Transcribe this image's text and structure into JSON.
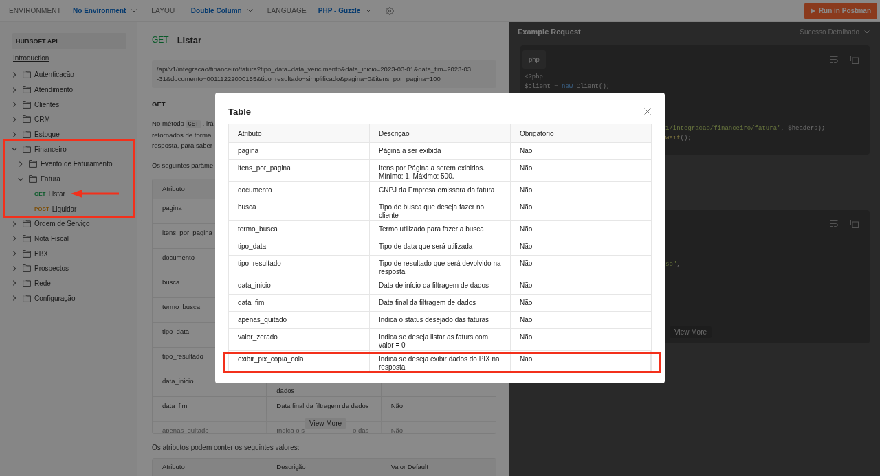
{
  "top_bar": {
    "settings": [
      {
        "label": "ENVIRONMENT",
        "value": "No Environment"
      },
      {
        "label": "LAYOUT",
        "value": "Double Column"
      },
      {
        "label": "LANGUAGE",
        "value": "PHP - Guzzle"
      }
    ],
    "run_button": "Run in Postman"
  },
  "sidebar": {
    "title": "HUBSOFT API",
    "intro_link": "Introduction",
    "items": [
      {
        "kind": "folder",
        "label": "Autenticação",
        "expanded": false,
        "highlighted": false
      },
      {
        "kind": "folder",
        "label": "Atendimento",
        "expanded": false,
        "highlighted": false
      },
      {
        "kind": "folder",
        "label": "Clientes",
        "expanded": false,
        "highlighted": false
      },
      {
        "kind": "folder",
        "label": "CRM",
        "expanded": false,
        "highlighted": false
      },
      {
        "kind": "folder",
        "label": "Estoque",
        "expanded": false,
        "highlighted": false
      },
      {
        "kind": "folder",
        "label": "Financeiro",
        "expanded": true,
        "highlighted": true,
        "children": [
          {
            "kind": "folder",
            "label": "Evento de Faturamento",
            "expanded": false
          },
          {
            "kind": "folder",
            "label": "Fatura",
            "expanded": true,
            "children": [
              {
                "kind": "request",
                "method": "GET",
                "label": "Listar",
                "arrow": true
              },
              {
                "kind": "request",
                "method": "POST",
                "label": "Liquidar",
                "arrow": false
              }
            ]
          }
        ]
      },
      {
        "kind": "folder",
        "label": "Ordem de Serviço",
        "expanded": false,
        "highlighted": false
      },
      {
        "kind": "folder",
        "label": "Nota Fiscal",
        "expanded": false,
        "highlighted": false
      },
      {
        "kind": "folder",
        "label": "PBX",
        "expanded": false,
        "highlighted": false
      },
      {
        "kind": "folder",
        "label": "Prospectos",
        "expanded": false,
        "highlighted": false
      },
      {
        "kind": "folder",
        "label": "Rede",
        "expanded": false,
        "highlighted": false
      },
      {
        "kind": "folder",
        "label": "Configuração",
        "expanded": false,
        "highlighted": false
      }
    ]
  },
  "main": {
    "method": "GET",
    "title": "Listar",
    "url": "/api/v1/integracao/financeiro/fatura?tipo_data=data_vencimento&data_inicio=2023-03-01&data_fim=2023-03-31&documento=00111222000155&tipo_resultado=simplificado&pagina=0&itens_por_pagina=100",
    "section_heading": "GET",
    "description_lines": [
      [
        {
          "kind": "text",
          "text": "No método "
        },
        {
          "kind": "code",
          "text": "GET"
        },
        {
          "kind": "text",
          "text": " , irá"
        }
      ],
      [
        {
          "kind": "text",
          "text": "retornados de forma"
        }
      ],
      [
        {
          "kind": "text",
          "text": "resposta, para saber"
        }
      ]
    ],
    "params_intro": "Os seguintes parâme",
    "params_table": {
      "columns": [
        "Atributo"
      ],
      "rows": [
        {
          "attribute": "pagina"
        },
        {
          "attribute": "itens_por_pagina"
        },
        {
          "attribute": "documento"
        },
        {
          "attribute": "busca"
        },
        {
          "attribute": "termo_busca"
        },
        {
          "attribute": "tipo_data"
        },
        {
          "attribute": "tipo_resultado"
        },
        {
          "attribute": "data_inicio",
          "description": [
            "dados"
          ]
        },
        {
          "attribute": "data_fim",
          "description": [
            "Data final da filtragem de dados"
          ],
          "required": "Não"
        },
        {
          "attribute": "apenas_quitado",
          "description": [
            "Indica o s",
            "o das"
          ],
          "required": "Não"
        }
      ]
    },
    "view_more": "View More",
    "values_intro": "Os atributos podem conter os seguintes valores:",
    "values_table": {
      "columns": [
        "Atributo",
        "Descrição",
        "Valor Default"
      ]
    }
  },
  "right_panel": {
    "title": "Example Request",
    "example": "Sucesso Detalhado",
    "request_code": {
      "language": "php",
      "lines": [
        {
          "kind": "full",
          "tokens": [
            {
              "kind": "meta",
              "text": "<?php"
            }
          ]
        },
        {
          "kind": "full",
          "tokens": [
            {
              "kind": "plain",
              "text": "$client = "
            },
            {
              "kind": "keyword",
              "text": "new"
            },
            {
              "kind": "plain",
              "text": " Client();"
            }
          ]
        },
        {
          "kind": "cut",
          "tokens": [
            {
              "kind": "string",
              "text": "1/integracao/financeiro/fatura'"
            },
            {
              "kind": "plain",
              "text": ", $headers);"
            }
          ]
        },
        {
          "kind": "cut",
          "tokens": [
            {
              "kind": "method",
              "text": "wait"
            },
            {
              "kind": "plain",
              "text": "();"
            }
          ]
        }
      ]
    },
    "response_code": {
      "lines": [
        {
          "kind": "cut",
          "tokens": [
            {
              "kind": "string",
              "text": "so\""
            },
            {
              "kind": "plain",
              "text": ","
            }
          ]
        }
      ]
    },
    "view_more": "View More"
  },
  "modal": {
    "title": "Table",
    "table": {
      "columns": [
        "Atributo",
        "Descrição",
        "Obrigatório"
      ],
      "rows": [
        {
          "attribute": "pagina",
          "description": "Página a ser exibida",
          "required": "Não",
          "highlighted": false
        },
        {
          "attribute": "itens_por_pagina",
          "description": "Itens por Página a serem exibidos. Mínimo: 1, Máximo: 500.",
          "required": "Não",
          "highlighted": false
        },
        {
          "attribute": "documento",
          "description": "CNPJ da Empresa emissora da fatura",
          "required": "Não",
          "highlighted": false
        },
        {
          "attribute": "busca",
          "description": "Tipo de busca que deseja fazer no cliente",
          "required": "Não",
          "highlighted": false
        },
        {
          "attribute": "termo_busca",
          "description": "Termo utilizado para fazer a busca",
          "required": "Não",
          "highlighted": false
        },
        {
          "attribute": "tipo_data",
          "description": "Tipo de data que será utilizada",
          "required": "Não",
          "highlighted": false
        },
        {
          "attribute": "tipo_resultado",
          "description": "Tipo de resultado que será devolvido na resposta",
          "required": "Não",
          "highlighted": false
        },
        {
          "attribute": "data_inicio",
          "description": "Data de início da filtragem de dados",
          "required": "Não",
          "highlighted": false
        },
        {
          "attribute": "data_fim",
          "description": "Data final da filtragem de dados",
          "required": "Não",
          "highlighted": false
        },
        {
          "attribute": "apenas_quitado",
          "description": "Indica o status desejado das faturas",
          "required": "Não",
          "highlighted": false
        },
        {
          "attribute": "valor_zerado",
          "description": "Indica se deseja listar as faturs com valor = 0",
          "required": "Não",
          "highlighted": false
        },
        {
          "attribute": "exibir_pix_copia_cola",
          "description": "Indica se deseja exibir dados do PIX na resposta",
          "required": "Não",
          "highlighted": true
        }
      ]
    }
  }
}
